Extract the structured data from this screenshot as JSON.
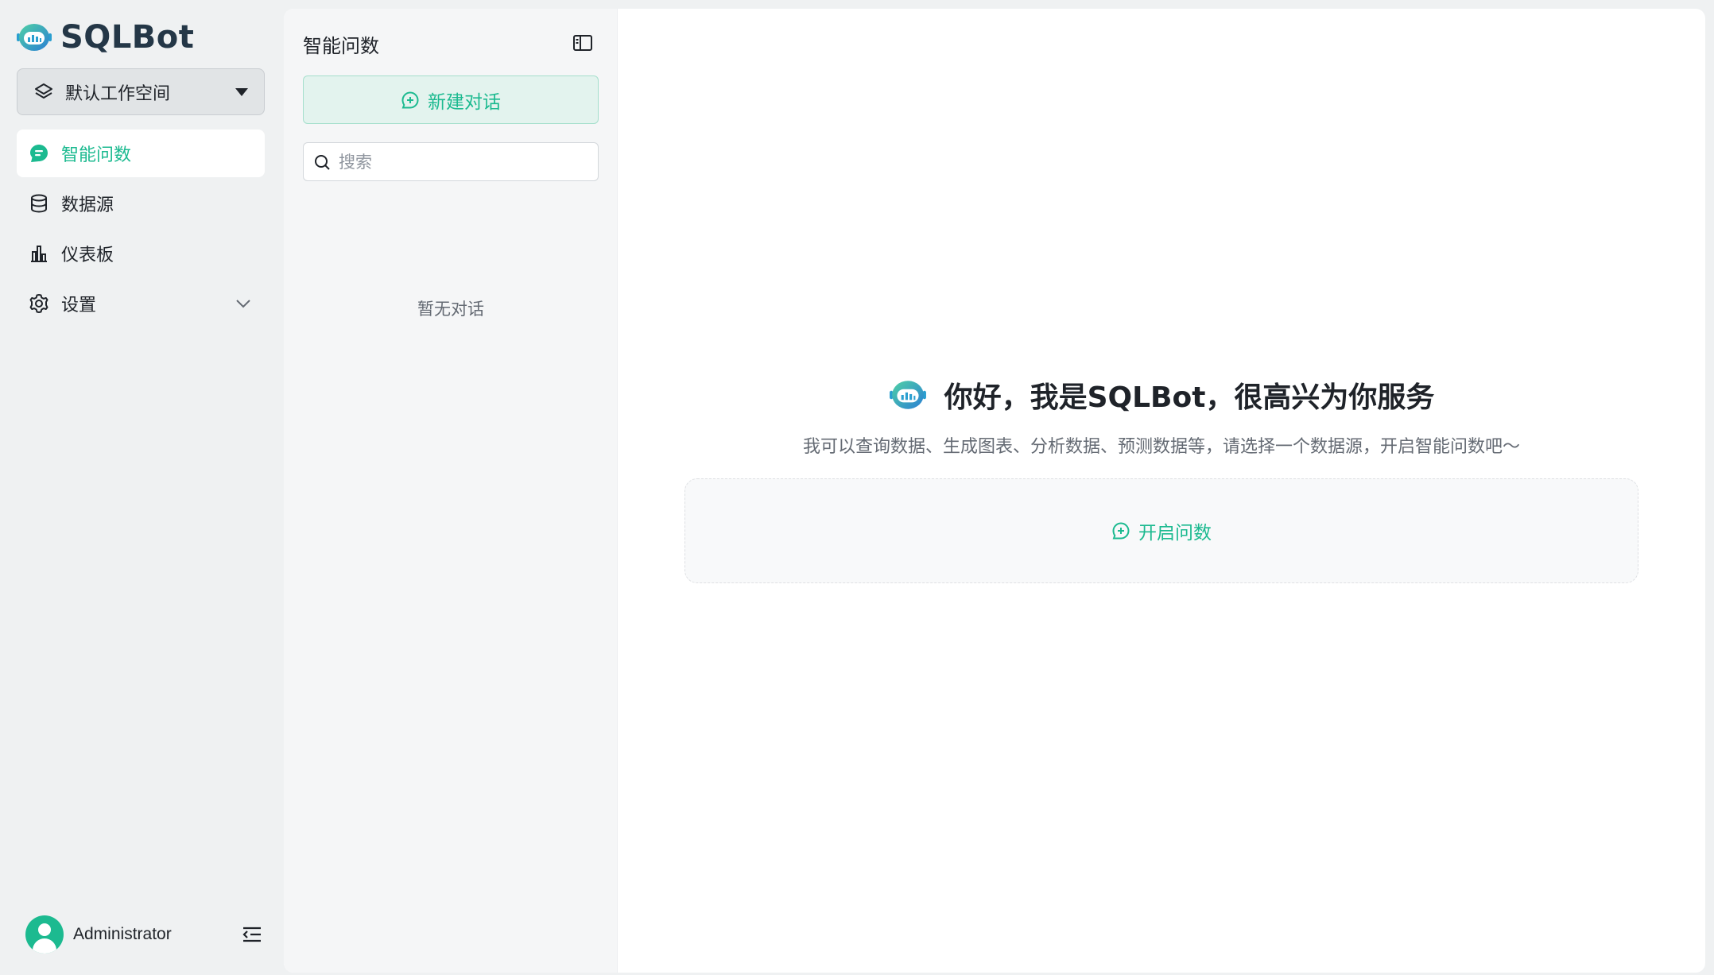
{
  "app": {
    "name": "SQLBot",
    "accent_color": "#1cba90",
    "logo_icon": "robot-logo-icon"
  },
  "workspace": {
    "label": "默认工作空间"
  },
  "sidebar": {
    "items": [
      {
        "label": "智能问数",
        "icon": "chat-bubble-icon",
        "active": true
      },
      {
        "label": "数据源",
        "icon": "database-icon",
        "active": false
      },
      {
        "label": "仪表板",
        "icon": "bar-chart-icon",
        "active": false
      },
      {
        "label": "设置",
        "icon": "gear-icon",
        "active": false,
        "expandable": true
      }
    ]
  },
  "user": {
    "name": "Administrator"
  },
  "history": {
    "title": "智能问数",
    "new_chat_label": "新建对话",
    "search_placeholder": "搜索",
    "empty_text": "暂无对话"
  },
  "welcome": {
    "title": "你好，我是SQLBot，很高兴为你服务",
    "subtitle": "我可以查询数据、生成图表、分析数据、预测数据等，请选择一个数据源，开启智能问数吧～",
    "start_label": "开启问数"
  }
}
